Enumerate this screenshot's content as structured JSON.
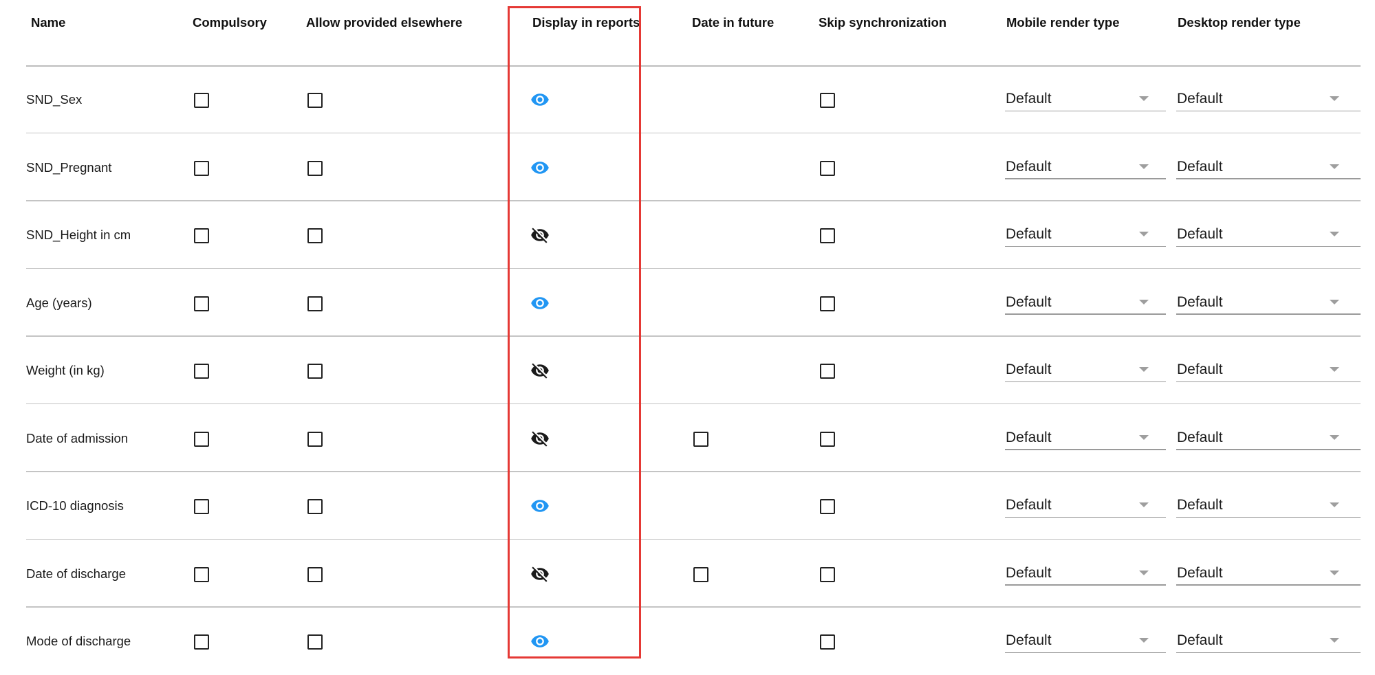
{
  "headers": {
    "name": "Name",
    "compulsory": "Compulsory",
    "allow_provided_elsewhere": "Allow provided elsewhere",
    "display_in_reports": "Display in reports",
    "date_in_future": "Date in future",
    "skip_synchronization": "Skip synchronization",
    "mobile_render_type": "Mobile render type",
    "desktop_render_type": "Desktop render type"
  },
  "rows": [
    {
      "name": "SND_Sex",
      "compulsory": false,
      "allow_provided_elsewhere": false,
      "display_in_reports": true,
      "date_in_future": null,
      "skip_synchronization": false,
      "mobile_render_type": "Default",
      "desktop_render_type": "Default"
    },
    {
      "name": "SND_Pregnant",
      "compulsory": false,
      "allow_provided_elsewhere": false,
      "display_in_reports": true,
      "date_in_future": null,
      "skip_synchronization": false,
      "mobile_render_type": "Default",
      "desktop_render_type": "Default"
    },
    {
      "name": "SND_Height in cm",
      "compulsory": false,
      "allow_provided_elsewhere": false,
      "display_in_reports": false,
      "date_in_future": null,
      "skip_synchronization": false,
      "mobile_render_type": "Default",
      "desktop_render_type": "Default"
    },
    {
      "name": "Age (years)",
      "compulsory": false,
      "allow_provided_elsewhere": false,
      "display_in_reports": true,
      "date_in_future": null,
      "skip_synchronization": false,
      "mobile_render_type": "Default",
      "desktop_render_type": "Default"
    },
    {
      "name": "Weight (in kg)",
      "compulsory": false,
      "allow_provided_elsewhere": false,
      "display_in_reports": false,
      "date_in_future": null,
      "skip_synchronization": false,
      "mobile_render_type": "Default",
      "desktop_render_type": "Default"
    },
    {
      "name": "Date of admission",
      "compulsory": false,
      "allow_provided_elsewhere": false,
      "display_in_reports": false,
      "date_in_future": false,
      "skip_synchronization": false,
      "mobile_render_type": "Default",
      "desktop_render_type": "Default"
    },
    {
      "name": "ICD-10 diagnosis",
      "compulsory": false,
      "allow_provided_elsewhere": false,
      "display_in_reports": true,
      "date_in_future": null,
      "skip_synchronization": false,
      "mobile_render_type": "Default",
      "desktop_render_type": "Default"
    },
    {
      "name": "Date of discharge",
      "compulsory": false,
      "allow_provided_elsewhere": false,
      "display_in_reports": false,
      "date_in_future": false,
      "skip_synchronization": false,
      "mobile_render_type": "Default",
      "desktop_render_type": "Default"
    },
    {
      "name": "Mode of discharge",
      "compulsory": false,
      "allow_provided_elsewhere": false,
      "display_in_reports": true,
      "date_in_future": null,
      "skip_synchronization": false,
      "mobile_render_type": "Default",
      "desktop_render_type": "Default"
    }
  ],
  "icons": {
    "visible": "eye-icon",
    "hidden": "eye-off-icon",
    "dropdown": "caret-down-icon"
  },
  "colors": {
    "visible_icon": "#2196f3",
    "hidden_icon": "#1a1a1a",
    "highlight_border": "#e53935"
  }
}
